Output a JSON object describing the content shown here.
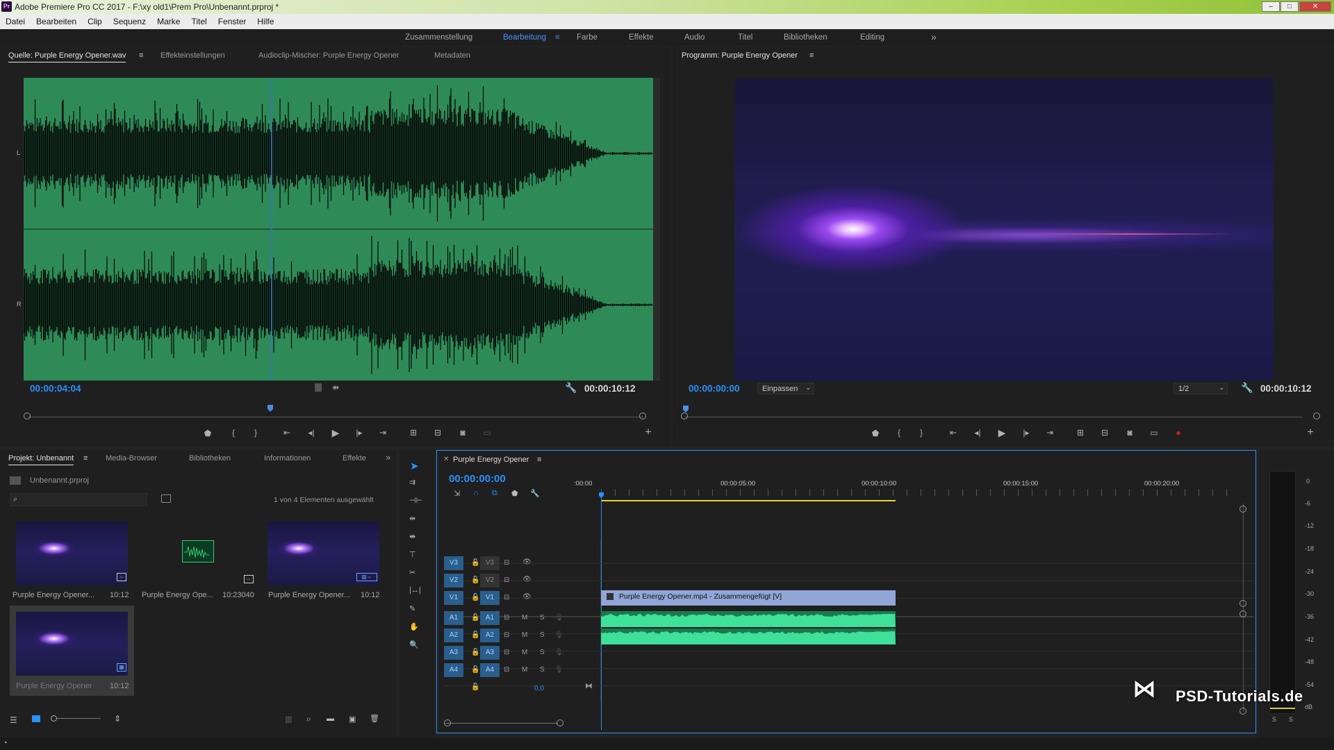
{
  "window": {
    "title": "Adobe Premiere Pro CC 2017 - F:\\xy old1\\Prem Pro\\Unbenannt.prproj *",
    "app_badge": "Pr",
    "min": "–",
    "max": "□",
    "close": "✕"
  },
  "menu": [
    "Datei",
    "Bearbeiten",
    "Clip",
    "Sequenz",
    "Marke",
    "Titel",
    "Fenster",
    "Hilfe"
  ],
  "workspaces": {
    "items": [
      "Zusammenstellung",
      "Bearbeitung",
      "Farbe",
      "Effekte",
      "Audio",
      "Titel",
      "Bibliotheken",
      "Editing"
    ],
    "active": "Bearbeitung",
    "overflow": "»"
  },
  "source": {
    "tabs": [
      "Quelle: Purple Energy Opener.wav",
      "Effekteinstellungen",
      "Audioclip-Mischer: Purple Energy Opener",
      "Metadaten"
    ],
    "current_tc": "00:00:04:04",
    "duration_tc": "00:00:10:12",
    "channel_left": "L",
    "channel_right": "R",
    "waveform_color": "#2e8b57"
  },
  "program": {
    "tab": "Programm: Purple Energy Opener",
    "current_tc": "00:00:00:00",
    "duration_tc": "00:00:10:12",
    "fit": "Einpassen",
    "resolution": "1/2"
  },
  "project": {
    "tabs": [
      "Projekt: Unbenannt",
      "Media-Browser",
      "Bibliotheken",
      "Informationen",
      "Effekte"
    ],
    "file": "Unbenannt.prproj",
    "selection_info": "1 von 4 Elementen ausgewählt",
    "items": [
      {
        "name": "Purple Energy Opener...",
        "duration": "10:12"
      },
      {
        "name": "Purple Energy Ope...",
        "duration": "10:23040"
      },
      {
        "name": "Purple Energy Opener...",
        "duration": "10:12"
      },
      {
        "name": "Purple Energy Opener",
        "duration": "10:12"
      }
    ]
  },
  "timeline": {
    "tab": "Purple Energy Opener",
    "current_tc": "00:00:00:00",
    "ruler": [
      ":00:00",
      "00:00:05:00",
      "00:00:10:00",
      "00:00:15:00",
      "00:00:20:00"
    ],
    "tracks": [
      {
        "src": "V3",
        "name": "V3"
      },
      {
        "src": "V2",
        "name": "V2"
      },
      {
        "src": "V1",
        "name": "V1"
      },
      {
        "src": "A1",
        "name": "A1"
      },
      {
        "src": "A2",
        "name": "A2"
      },
      {
        "src": "A3",
        "name": "A3"
      },
      {
        "src": "A4",
        "name": "A4"
      }
    ],
    "mute": "M",
    "solo": "S",
    "video_clip": "Purple Energy Opener.mp4 - Zusammengefügt [V]",
    "master_value": "0,0"
  },
  "meters": {
    "labels": [
      "0",
      "-6",
      "-12",
      "-18",
      "-24",
      "-30",
      "-36",
      "-42",
      "-48",
      "-54",
      "dB"
    ],
    "solo_s": "S",
    "solo_s2": "S"
  },
  "watermark": "PSD-Tutorials.de"
}
